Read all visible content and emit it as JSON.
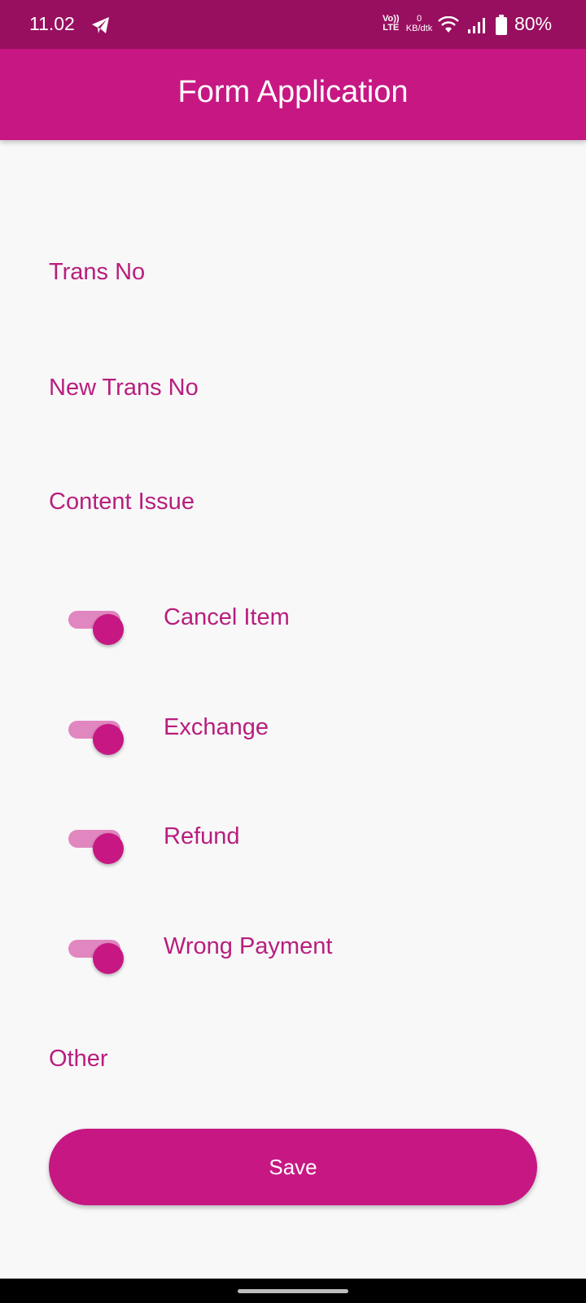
{
  "status_bar": {
    "time": "11.02",
    "volte_top": "Vo))",
    "volte_bottom": "LTE",
    "net_speed_value": "0",
    "net_speed_unit": "KB/dtk",
    "battery": "80%",
    "icons": [
      "telegram-icon",
      "wifi-icon",
      "signal-icon",
      "battery-icon"
    ]
  },
  "app_bar": {
    "title": "Form Application"
  },
  "form": {
    "trans_no_label": "Trans No",
    "new_trans_no_label": "New Trans No",
    "content_issue_label": "Content Issue",
    "switches": [
      {
        "label": "Cancel Item",
        "on": true
      },
      {
        "label": "Exchange",
        "on": true
      },
      {
        "label": "Refund",
        "on": true
      },
      {
        "label": "Wrong Payment",
        "on": true
      }
    ],
    "other_label": "Other",
    "save_label": "Save"
  },
  "colors": {
    "status_bar": "#990f60",
    "primary": "#c71783",
    "label_text": "#b81e7d",
    "switch_track": "#e187bf",
    "background": "#f8f8f9"
  }
}
